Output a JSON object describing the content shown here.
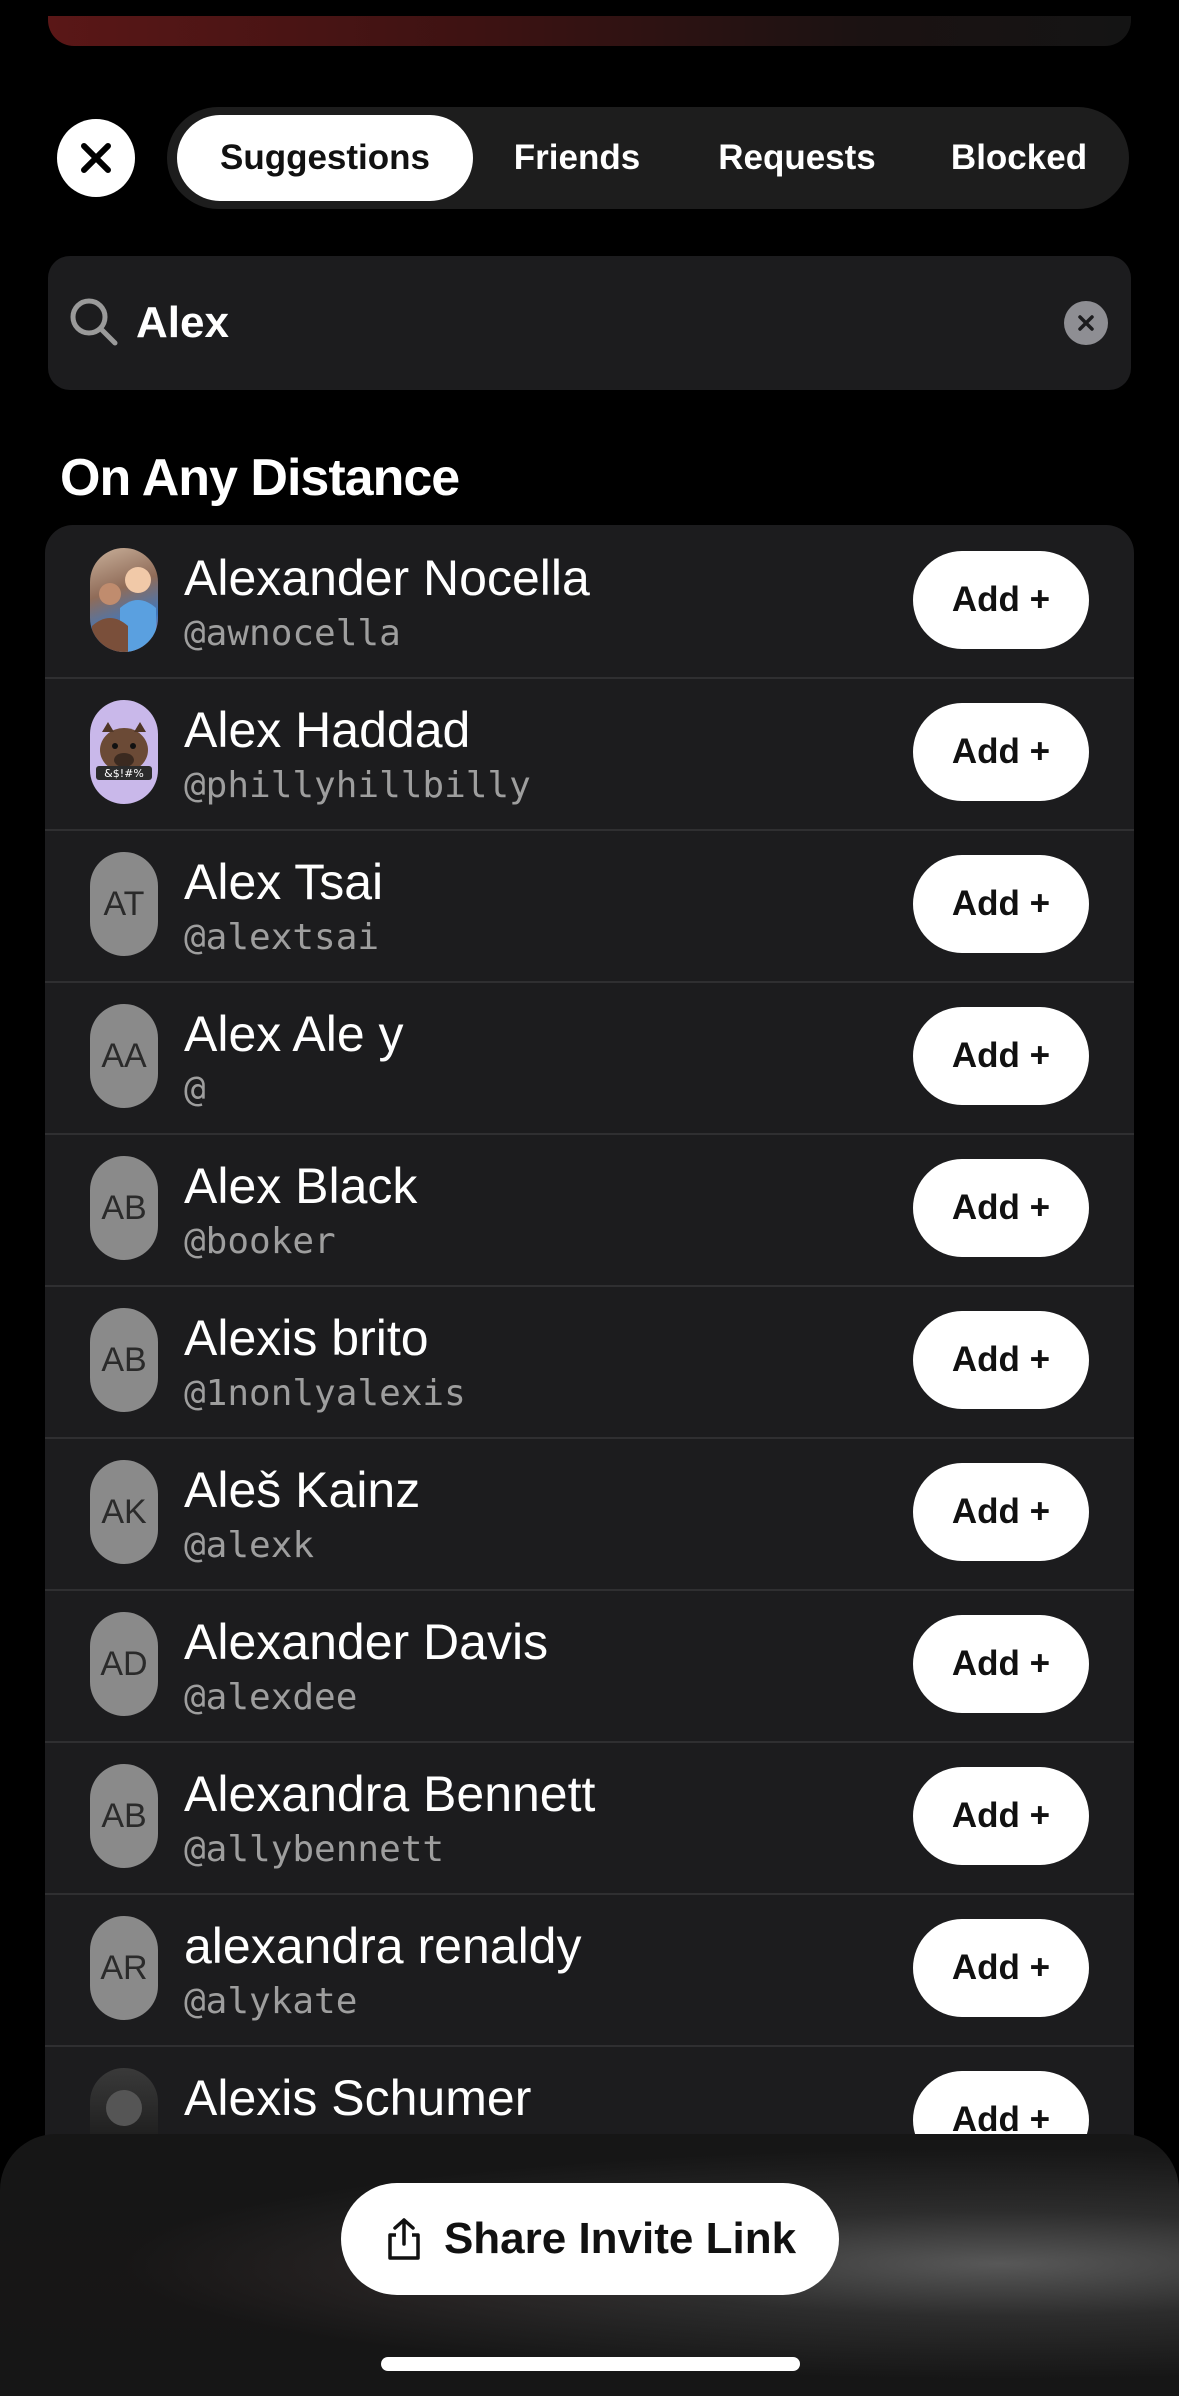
{
  "tabs": [
    {
      "label": "Suggestions",
      "active": true
    },
    {
      "label": "Friends",
      "active": false
    },
    {
      "label": "Requests",
      "active": false
    },
    {
      "label": "Blocked",
      "active": false
    }
  ],
  "search": {
    "value": "Alex"
  },
  "section_title": "On Any Distance",
  "add_label": "Add +",
  "people": [
    {
      "name": "Alexander Nocella",
      "handle": "@awnocella",
      "initials": "",
      "avatar": "photo"
    },
    {
      "name": "Alex Haddad",
      "handle": "@phillyhillbilly",
      "initials": "",
      "avatar": "boar-sticker",
      "avatar_text": "&$!#%"
    },
    {
      "name": "Alex Tsai",
      "handle": "@alextsai",
      "initials": "AT",
      "avatar": "initials"
    },
    {
      "name": "Alex Ale y",
      "handle": "@",
      "initials": "AA",
      "avatar": "initials"
    },
    {
      "name": "Alex Black",
      "handle": "@booker",
      "initials": "AB",
      "avatar": "initials"
    },
    {
      "name": "Alexis brito",
      "handle": "@1nonlyalexis",
      "initials": "AB",
      "avatar": "initials"
    },
    {
      "name": "Aleš Kainz",
      "handle": "@alexk",
      "initials": "AK",
      "avatar": "initials"
    },
    {
      "name": "Alexander Davis",
      "handle": "@alexdee",
      "initials": "AD",
      "avatar": "initials"
    },
    {
      "name": "Alexandra Bennett",
      "handle": "@allybennett",
      "initials": "AB",
      "avatar": "initials"
    },
    {
      "name": "alexandra renaldy",
      "handle": "@alykate",
      "initials": "AR",
      "avatar": "initials"
    },
    {
      "name": "Alexis Schumer",
      "handle": "",
      "initials": "",
      "avatar": "photo-dark"
    }
  ],
  "share_label": "Share Invite Link",
  "colors": {
    "background": "#000000",
    "list_bg": "#1c1c1e",
    "avatar_gray": "#8a8a8a",
    "accent_red": "#5a1717"
  }
}
